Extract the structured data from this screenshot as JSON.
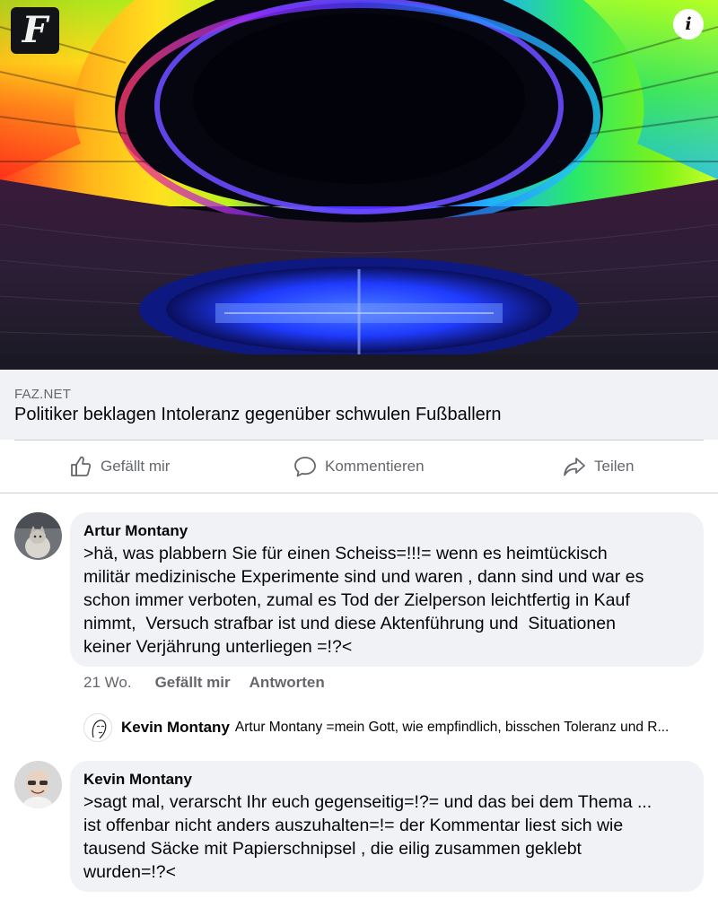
{
  "post": {
    "brand_logo": "F",
    "info_icon": "i",
    "link": {
      "source": "FAZ.NET",
      "title": "Politiker beklagen Intoleranz gegenüber schwulen Fußballern"
    },
    "actions": {
      "like": "Gefällt mir",
      "comment": "Kommentieren",
      "share": "Teilen"
    }
  },
  "comments": [
    {
      "author": "Artur Montany",
      "lines": [
        ">hä, was plabbern Sie für einen Scheiss=!!!= wenn es heimtückisch",
        "militär medizinische Experimente sind und waren , dann sind und war es",
        "schon immer verboten, zumal es Tod der Zielperson leichtfertig in Kauf",
        "nimmt,  Versuch strafbar ist und diese Aktenführung und  Situationen",
        "keiner Verjährung unterliegen =!?<"
      ],
      "time": "21 Wo.",
      "like_label": "Gefällt mir",
      "reply_label": "Antworten",
      "reply_preview": {
        "author": "Kevin Montany",
        "text": "Artur Montany =mein Gott, wie empfindlich, bisschen Toleranz und R..."
      }
    },
    {
      "author": "Kevin Montany",
      "lines": [
        ">sagt mal, verarscht Ihr euch gegenseitig=!?= und das bei dem Thema ...",
        "ist offenbar nicht anders auszuhalten=!= der Kommentar liest sich wie",
        "tausend Säcke mit Papierschnipsel , die eilig zusammen geklebt",
        "wurden=!?<"
      ]
    }
  ],
  "icons": {
    "like": "thumbs-up-icon",
    "comment": "speech-bubble-icon",
    "share": "share-arrow-icon"
  },
  "colors": {
    "text_secondary": "#65676b",
    "bubble_bg": "#f0f2f5",
    "divider": "#ced0d4"
  }
}
